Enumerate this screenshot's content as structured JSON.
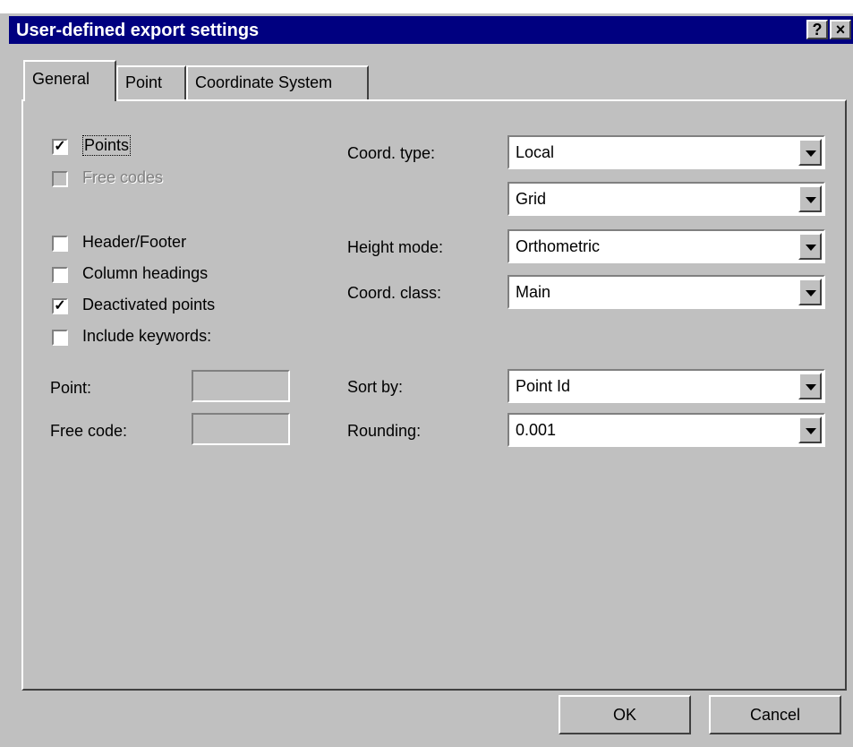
{
  "window": {
    "title": "User-defined export settings",
    "help_label": "?",
    "close_label": "×"
  },
  "tabs": [
    {
      "label": "General",
      "active": true
    },
    {
      "label": "Point",
      "active": false
    },
    {
      "label": "Coordinate System",
      "active": false
    }
  ],
  "checkboxes": {
    "points": {
      "label": "Points",
      "checked": true,
      "enabled": true
    },
    "free_codes": {
      "label": "Free codes",
      "checked": false,
      "enabled": false
    },
    "header_footer": {
      "label": "Header/Footer",
      "checked": false,
      "enabled": true
    },
    "column_headings": {
      "label": "Column headings",
      "checked": false,
      "enabled": true
    },
    "deactivated_points": {
      "label": "Deactivated points",
      "checked": true,
      "enabled": true
    },
    "include_keywords": {
      "label": "Include keywords:",
      "checked": false,
      "enabled": true
    }
  },
  "keyword_fields": {
    "point": {
      "label": "Point:",
      "value": ""
    },
    "free_code": {
      "label": "Free code:",
      "value": ""
    }
  },
  "fields": {
    "coord_type": {
      "label": "Coord. type:",
      "value": "Local"
    },
    "grid": {
      "value": "Grid"
    },
    "height_mode": {
      "label": "Height mode:",
      "value": "Orthometric"
    },
    "coord_class": {
      "label": "Coord. class:",
      "value": "Main"
    },
    "sort_by": {
      "label": "Sort by:",
      "value": "Point Id"
    },
    "rounding": {
      "label": "Rounding:",
      "value": "0.001"
    }
  },
  "buttons": {
    "ok": "OK",
    "cancel": "Cancel"
  },
  "colors": {
    "titlebar": "#000080",
    "face": "#c0c0c0"
  }
}
